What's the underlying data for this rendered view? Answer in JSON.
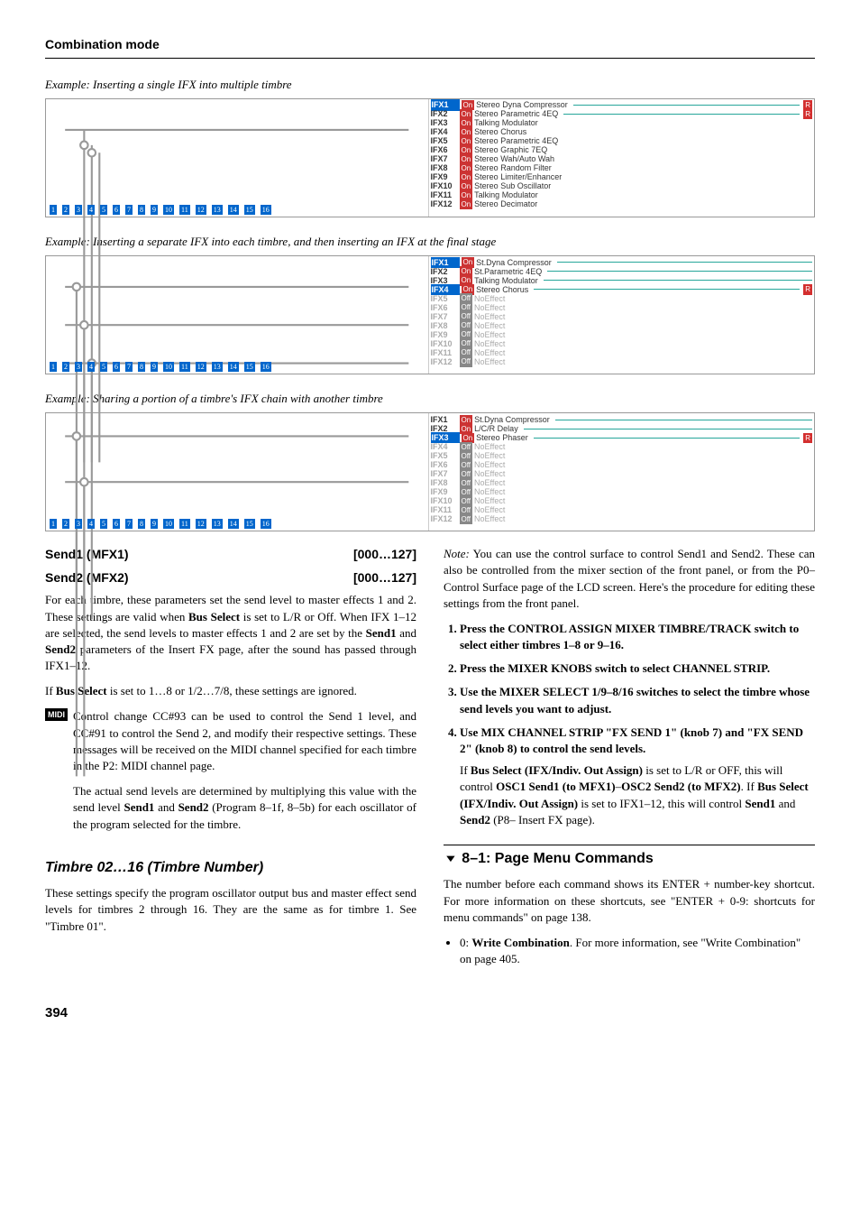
{
  "header": {
    "title": "Combination mode"
  },
  "examples": {
    "caption1": "Example: Inserting a single IFX into multiple timbre",
    "caption2": "Example: Inserting a separate IFX into each timbre, and then inserting an IFX at the final stage",
    "caption3": "Example: Sharing a portion of a timbre's IFX chain with another timbre"
  },
  "diagram1": {
    "track_nums": [
      "1",
      "2",
      "3",
      "4",
      "5",
      "6",
      "7",
      "8",
      "9",
      "10",
      "11",
      "12",
      "13",
      "14",
      "15",
      "16"
    ],
    "rows": [
      {
        "slot": "IFX1",
        "sel": true,
        "on": true,
        "name": "Stereo Dyna Compressor",
        "line": true,
        "r": true
      },
      {
        "slot": "IFX2",
        "on": true,
        "name": "Stereo Parametric 4EQ",
        "line": true,
        "r": true
      },
      {
        "slot": "IFX3",
        "on": true,
        "name": "Talking Modulator"
      },
      {
        "slot": "IFX4",
        "on": true,
        "name": "Stereo Chorus"
      },
      {
        "slot": "IFX5",
        "on": true,
        "name": "Stereo Parametric 4EQ"
      },
      {
        "slot": "IFX6",
        "on": true,
        "name": "Stereo Graphic 7EQ"
      },
      {
        "slot": "IFX7",
        "on": true,
        "name": "Stereo Wah/Auto Wah"
      },
      {
        "slot": "IFX8",
        "on": true,
        "name": "Stereo Random Filter"
      },
      {
        "slot": "IFX9",
        "on": true,
        "name": "Stereo Limiter/Enhancer"
      },
      {
        "slot": "IFX10",
        "on": true,
        "name": "Stereo Sub Oscillator"
      },
      {
        "slot": "IFX11",
        "on": true,
        "name": "Talking Modulator"
      },
      {
        "slot": "IFX12",
        "on": true,
        "name": "Stereo Decimator"
      }
    ]
  },
  "diagram2": {
    "track_nums": [
      "1",
      "2",
      "3",
      "4",
      "5",
      "6",
      "7",
      "8",
      "9",
      "10",
      "11",
      "12",
      "13",
      "14",
      "15",
      "16"
    ],
    "rows": [
      {
        "slot": "IFX1",
        "sel": true,
        "on": true,
        "name": "St.Dyna Compressor",
        "line": true
      },
      {
        "slot": "IFX2",
        "on": true,
        "name": "St.Parametric 4EQ",
        "line": true
      },
      {
        "slot": "IFX3",
        "on": true,
        "name": "Talking Modulator",
        "line": true
      },
      {
        "slot": "IFX4",
        "sel": true,
        "on": true,
        "name": "Stereo Chorus",
        "line": true,
        "r": true
      },
      {
        "slot": "IFX5",
        "dim": true,
        "on": false,
        "name": "NoEffect"
      },
      {
        "slot": "IFX6",
        "dim": true,
        "on": false,
        "name": "NoEffect"
      },
      {
        "slot": "IFX7",
        "dim": true,
        "on": false,
        "name": "NoEffect"
      },
      {
        "slot": "IFX8",
        "dim": true,
        "on": false,
        "name": "NoEffect"
      },
      {
        "slot": "IFX9",
        "dim": true,
        "on": false,
        "name": "NoEffect"
      },
      {
        "slot": "IFX10",
        "dim": true,
        "on": false,
        "name": "NoEffect"
      },
      {
        "slot": "IFX11",
        "dim": true,
        "on": false,
        "name": "NoEffect"
      },
      {
        "slot": "IFX12",
        "dim": true,
        "on": false,
        "name": "NoEffect"
      }
    ]
  },
  "diagram3": {
    "track_nums": [
      "1",
      "2",
      "3",
      "4",
      "5",
      "6",
      "7",
      "8",
      "9",
      "10",
      "11",
      "12",
      "13",
      "14",
      "15",
      "16"
    ],
    "rows": [
      {
        "slot": "IFX1",
        "on": true,
        "name": "St.Dyna Compressor",
        "line": true
      },
      {
        "slot": "IFX2",
        "on": true,
        "name": "L/C/R Delay",
        "line": true
      },
      {
        "slot": "IFX3",
        "sel": true,
        "on": true,
        "name": "Stereo Phaser",
        "line": true,
        "r": true
      },
      {
        "slot": "IFX4",
        "dim": true,
        "on": false,
        "name": "NoEffect"
      },
      {
        "slot": "IFX5",
        "dim": true,
        "on": false,
        "name": "NoEffect"
      },
      {
        "slot": "IFX6",
        "dim": true,
        "on": false,
        "name": "NoEffect"
      },
      {
        "slot": "IFX7",
        "dim": true,
        "on": false,
        "name": "NoEffect"
      },
      {
        "slot": "IFX8",
        "dim": true,
        "on": false,
        "name": "NoEffect"
      },
      {
        "slot": "IFX9",
        "dim": true,
        "on": false,
        "name": "NoEffect"
      },
      {
        "slot": "IFX10",
        "dim": true,
        "on": false,
        "name": "NoEffect"
      },
      {
        "slot": "IFX11",
        "dim": true,
        "on": false,
        "name": "NoEffect"
      },
      {
        "slot": "IFX12",
        "dim": true,
        "on": false,
        "name": "NoEffect"
      }
    ]
  },
  "params": {
    "send1_label": "Send1 (MFX1)",
    "send1_range": "[000…127]",
    "send2_label": "Send2 (MFX2)",
    "send2_range": "[000…127]"
  },
  "body": {
    "p1a": "For each timbre, these parameters set the send level to master effects 1 and 2. These settings are valid when ",
    "p1b": "Bus Select",
    "p1c": " is set to L/R or Off. When IFX 1–12 are selected, the send levels to master effects 1 and 2 are set by the ",
    "p1d": "Send1",
    "p1e": " and ",
    "p1f": "Send2",
    "p1g": " parameters of the Insert FX page, after the sound has passed through IFX1–12.",
    "p2a": "If ",
    "p2b": "Bus Select",
    "p2c": " is set to 1…8 or 1/2…7/8, these settings are ignored.",
    "midi_tag": "MIDI",
    "p3": "Control change CC#93 can be used to control the Send 1 level, and CC#91 to control the Send 2, and modify their respective settings. These messages will be received on the MIDI channel specified for each timbre in the P2: MIDI channel page.",
    "p4a": "The actual send levels are determined by multiplying this value with the send level ",
    "p4b": "Send1",
    "p4c": " and ",
    "p4d": "Send2",
    "p4e": " (Program 8–1f, 8–5b) for each oscillator of the program selected for the timbre.",
    "h3_timbre": "Timbre 02…16 (Timbre Number)",
    "p5": "These settings specify the program oscillator output bus and master effect send levels for timbres 2 through 16. They are the same as for timbre 1. See \"Timbre 01\".",
    "note_label": "Note:",
    "p6": " You can use the control surface to control Send1 and Send2. These can also be controlled from the mixer section of the front panel, or from the P0– Control Surface page of the LCD screen. Here's the procedure for editing these settings from the front panel.",
    "step1": "Press the CONTROL ASSIGN MIXER TIMBRE/TRACK switch to select either timbres 1–8 or 9–16.",
    "step2": "Press the MIXER KNOBS switch to select CHANNEL STRIP.",
    "step3": "Use the MIXER SELECT 1/9–8/16 switches to select the timbre whose send levels you want to adjust.",
    "step4": "Use MIX CHANNEL STRIP \"FX SEND 1\" (knob 7) and \"FX SEND 2\" (knob 8) to control the send levels.",
    "step4_note_a": "If ",
    "step4_note_b": "Bus Select (IFX/Indiv. Out Assign)",
    "step4_note_c": " is set to L/R or OFF, this will control ",
    "step4_note_d": "OSC1 Send1 (to MFX1)",
    "step4_note_e": "–",
    "step4_note_f": "OSC2 Send2 (to MFX2)",
    "step4_note_g": ". If ",
    "step4_note_h": "Bus Select (IFX/Indiv. Out Assign)",
    "step4_note_i": " is set to IFX1–12, this will control ",
    "step4_note_j": "Send1",
    "step4_note_k": " and ",
    "step4_note_l": "Send2",
    "step4_note_m": " (P8– Insert FX page).",
    "h3_menu": "8–1: Page Menu Commands",
    "p7": "The number before each command shows its ENTER + number-key shortcut. For more information on these shortcuts, see \"ENTER + 0-9: shortcuts for menu commands\" on page 138.",
    "bullet1a": "0: ",
    "bullet1b": "Write Combination",
    "bullet1c": ". For more information, see \"Write Combination\" on page 405."
  },
  "page_number": "394"
}
